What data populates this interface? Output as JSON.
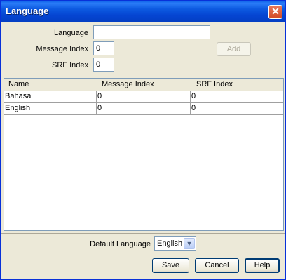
{
  "window": {
    "title": "Language"
  },
  "form": {
    "language_label": "Language",
    "language_value": "",
    "message_index_label": "Message Index",
    "message_index_value": "0",
    "srf_index_label": "SRF Index",
    "srf_index_value": "0",
    "add_label": "Add"
  },
  "table": {
    "headers": [
      "Name",
      "Message Index",
      "SRF Index"
    ],
    "rows": [
      [
        "Bahasa",
        "0",
        "0"
      ],
      [
        "English",
        "0",
        "0"
      ]
    ]
  },
  "footer": {
    "default_language_label": "Default Language",
    "default_language_value": "English",
    "save_label": "Save",
    "cancel_label": "Cancel",
    "help_label": "Help"
  },
  "icons": {
    "close": "close-icon",
    "dropdown": "chevron-down-icon"
  },
  "colors": {
    "titlebar": "#0a5fe6",
    "close": "#d24a25",
    "face": "#ece9d8",
    "border": "#7f9db9"
  }
}
